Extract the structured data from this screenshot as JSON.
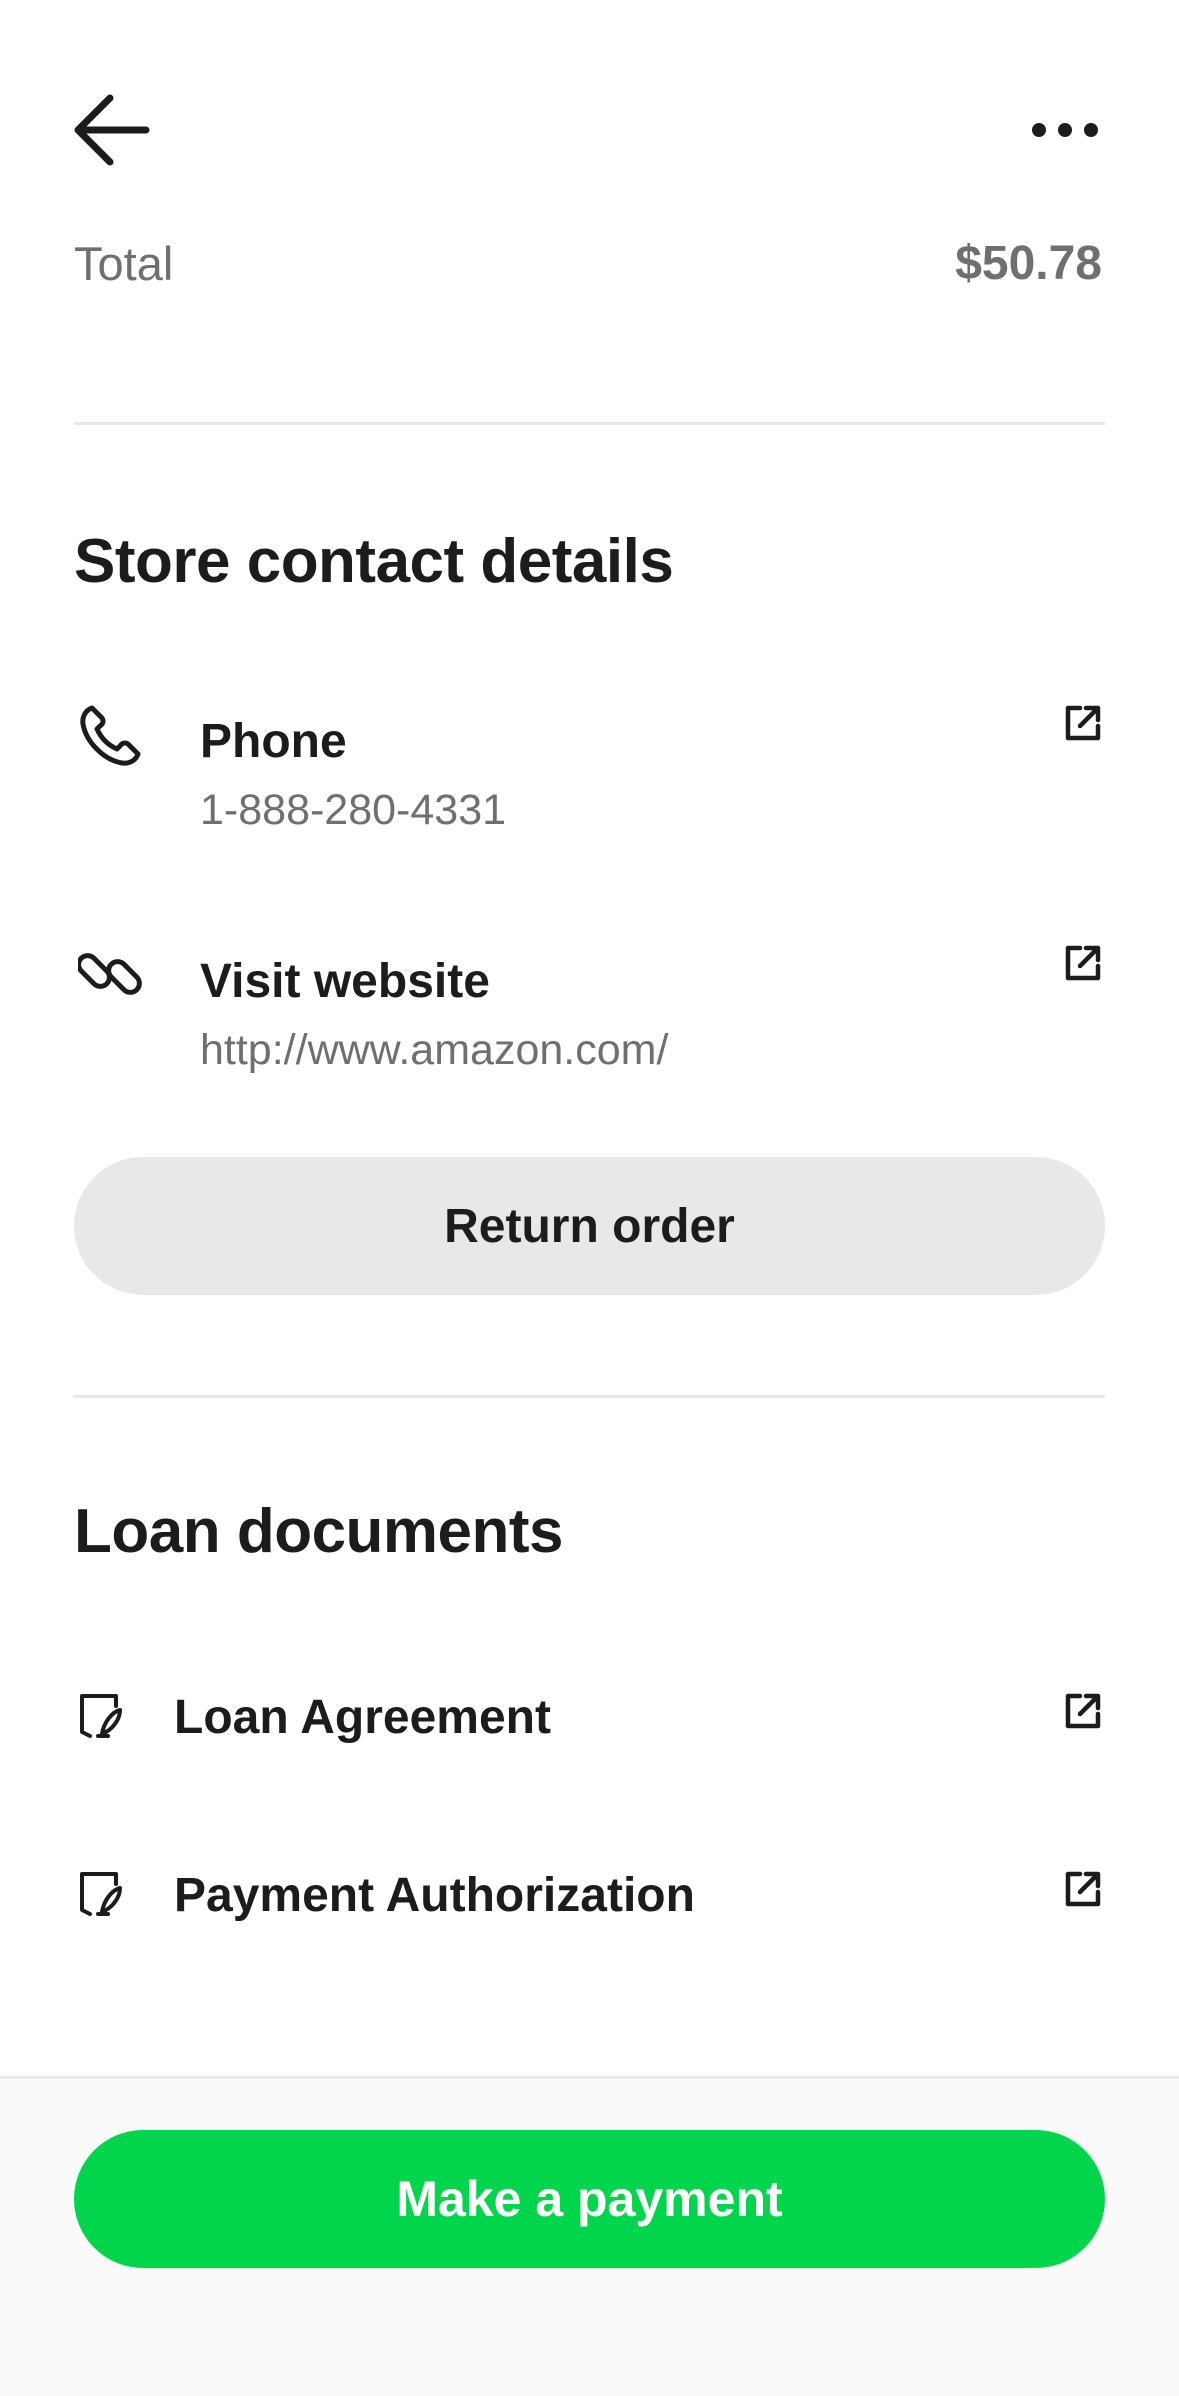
{
  "header": {
    "back_icon": "arrow-left-icon",
    "more_icon": "more-horizontal-icon"
  },
  "total": {
    "label": "Total",
    "value": "$50.78"
  },
  "store_contact": {
    "title": "Store contact details",
    "phone": {
      "icon": "phone-icon",
      "title": "Phone",
      "value": "1-888-280-4331",
      "action_icon": "external-link-icon"
    },
    "website": {
      "icon": "link-icon",
      "title": "Visit website",
      "value": "http://www.amazon.com/",
      "action_icon": "external-link-icon"
    },
    "return_button": "Return order"
  },
  "loan_documents": {
    "title": "Loan documents",
    "items": [
      {
        "icon": "document-sign-icon",
        "label": "Loan Agreement",
        "action_icon": "external-link-icon"
      },
      {
        "icon": "document-sign-icon",
        "label": "Payment Authorization",
        "action_icon": "external-link-icon"
      }
    ]
  },
  "footer": {
    "payment_button": "Make a payment"
  },
  "colors": {
    "accent": "#00d54b",
    "text_primary": "#1c1c1c",
    "text_secondary": "#6f6f6f",
    "button_grey": "#e8e8e8",
    "divider": "#e8e8e8"
  }
}
